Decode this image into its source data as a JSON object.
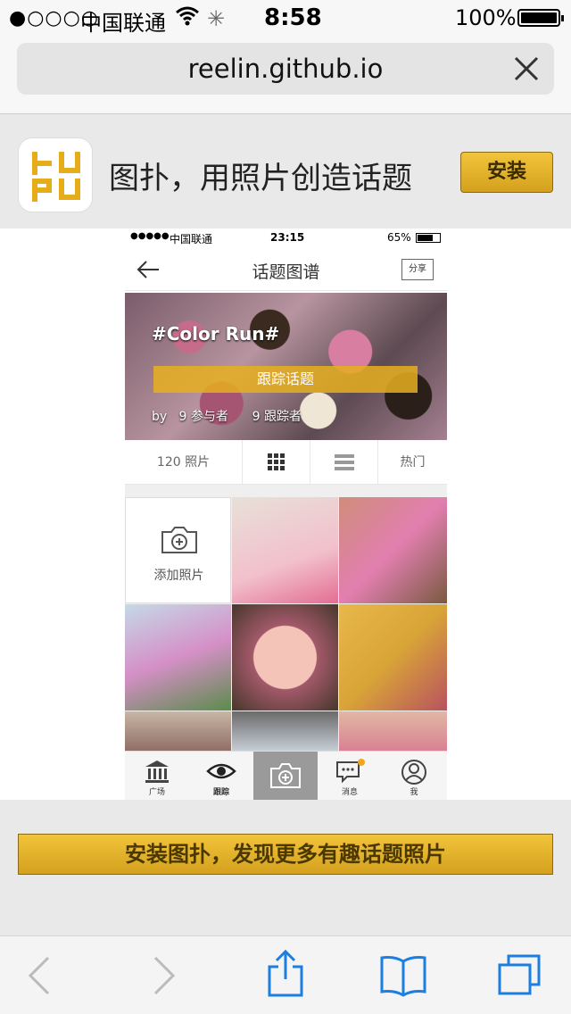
{
  "status_bar": {
    "signal": "●○○○○",
    "carrier": "中国联通",
    "time": "8:58",
    "battery_text": "100%"
  },
  "browser": {
    "url": "reelin.github.io"
  },
  "app_banner": {
    "title": "图扑，用照片创造话题",
    "install_label": "安装"
  },
  "phone": {
    "status": {
      "signal": "●●●●●",
      "carrier": "中国联通",
      "time": "23:15",
      "battery": "65%"
    },
    "header_title": "话题图谱",
    "share_label": "分享",
    "hero": {
      "tag": "#Color Run#",
      "follow_label": "跟踪话题",
      "by_label": "by",
      "participants": "9 参与者",
      "followers": "9 跟踪者"
    },
    "tabs": {
      "photos_count": "120 照片",
      "hot": "热门"
    },
    "add_photo_label": "添加照片",
    "nav": {
      "square": "广场",
      "follow": "跟踪",
      "messages": "消息",
      "me": "我"
    }
  },
  "wide_install_label": "安装图扑，发现更多有趣话题照片",
  "colors": {
    "accent_gold": "#e2b12c",
    "toolbar_blue": "#1a7fe0"
  }
}
